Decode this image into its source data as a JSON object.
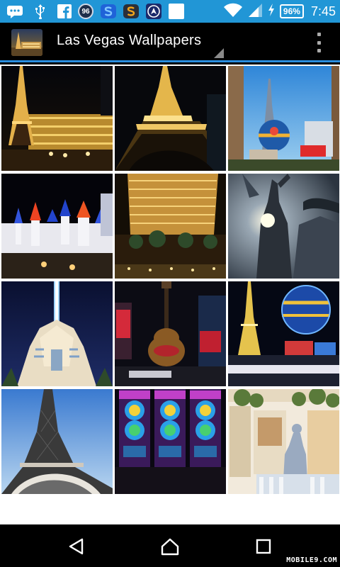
{
  "status_bar": {
    "badge_number": "96",
    "battery_percent": "96%",
    "time": "7:45",
    "icons": [
      "message-icon",
      "usb-icon",
      "facebook-icon",
      "badge-96-icon",
      "s-logo-icon",
      "s-logo-orange-icon",
      "arrow-app-icon",
      "blank-app-icon",
      "wifi-icon",
      "signal-icon",
      "battery-charging-icon"
    ]
  },
  "app_bar": {
    "title": "Las Vegas Wallpapers",
    "icons": [
      "app-logo",
      "spinner-dropdown-icon",
      "overflow-menu-icon"
    ]
  },
  "wallpapers": [
    {
      "subject": "paris-hotel-eiffel-night"
    },
    {
      "subject": "eiffel-tower-base-night"
    },
    {
      "subject": "paris-balloon-day"
    },
    {
      "subject": "excalibur-castle-night"
    },
    {
      "subject": "bellagio-hotel-night"
    },
    {
      "subject": "statue-of-liberty-silhouette"
    },
    {
      "subject": "luxor-sphinx-beam"
    },
    {
      "subject": "hard-rock-guitar-sign"
    },
    {
      "subject": "eiffel-and-balloon-night"
    },
    {
      "subject": "eiffel-tower-day"
    },
    {
      "subject": "vegas-hits-slot-machines"
    },
    {
      "subject": "venetian-statue-facade"
    }
  ],
  "nav_bar": {
    "icons": [
      "back-icon",
      "home-icon",
      "recents-icon"
    ],
    "watermark": "MOBILE9.COM"
  },
  "colors": {
    "status_bar": "#2196d6",
    "accent": "#2a8ee0",
    "background": "#000000"
  }
}
